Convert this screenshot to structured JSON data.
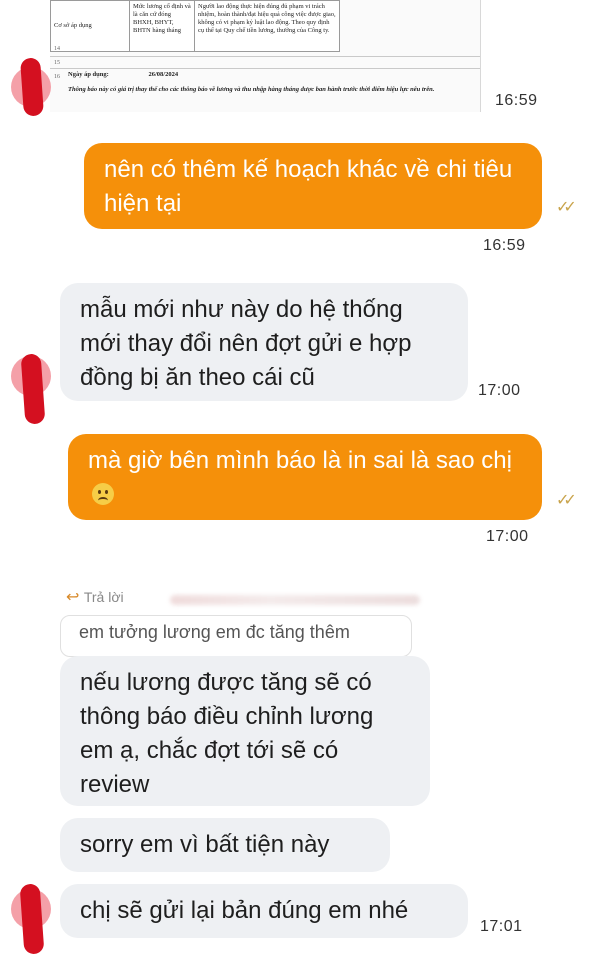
{
  "doc_preview": {
    "row_numbers": [
      "14",
      "15",
      "16"
    ],
    "table_col1": "Cơ sở áp dụng",
    "table_col2": "Mức lương cố định và là căn cứ đóng BHXH, BHYT, BHTN hàng tháng",
    "table_col3": "Người lao động thực hiện đúng đủ phạm vi trách nhiệm, hoàn thành/đạt hiệu quả công việc được giao, không có vi phạm kỷ luật lao động. Theo quy định cụ thể tại Quy chế tiền lương, thưởng của Công ty.",
    "effective_label": "Ngày áp dụng:",
    "effective_date": "26/08/2024",
    "notice": "Thông báo này có giá trị thay thế cho các thông báo về lương và thu nhập hàng tháng được ban hành trước thời điểm hiệu lực nêu trên."
  },
  "messages": {
    "m0_time": "16:59",
    "m1_text": "nên có thêm kế hoạch khác về chi tiêu hiện tại",
    "m1_time": "16:59",
    "m2_text": "mẫu mới như này do hệ thống mới thay đổi nên đợt gửi e hợp đồng bị ăn theo cái cũ",
    "m2_time": "17:00",
    "m3_text": "mà giờ bên mình báo là in sai là sao chị",
    "m3_time": "17:00",
    "reply_label": "Trả lời",
    "quote_text": "em tưởng lương em đc tăng thêm",
    "m4_text": "nếu lương được tăng sẽ có thông báo điều chỉnh lương em ạ, chắc đợt tới sẽ có review",
    "m5_text": "sorry em vì bất tiện này",
    "m6_text": "chị sẽ gửi lại bản đúng em nhé",
    "m6_time": "17:01"
  },
  "icons": {
    "read_receipt": "double-check-icon",
    "reply": "reply-arrow-icon",
    "emoji": "slightly-frowning-face-icon",
    "avatar": "avatar-redacted"
  },
  "colors": {
    "outgoing_bubble": "#f5900a",
    "incoming_bubble": "#eef0f3",
    "redaction": "#d41020",
    "read_receipt": "#c9a44c"
  }
}
